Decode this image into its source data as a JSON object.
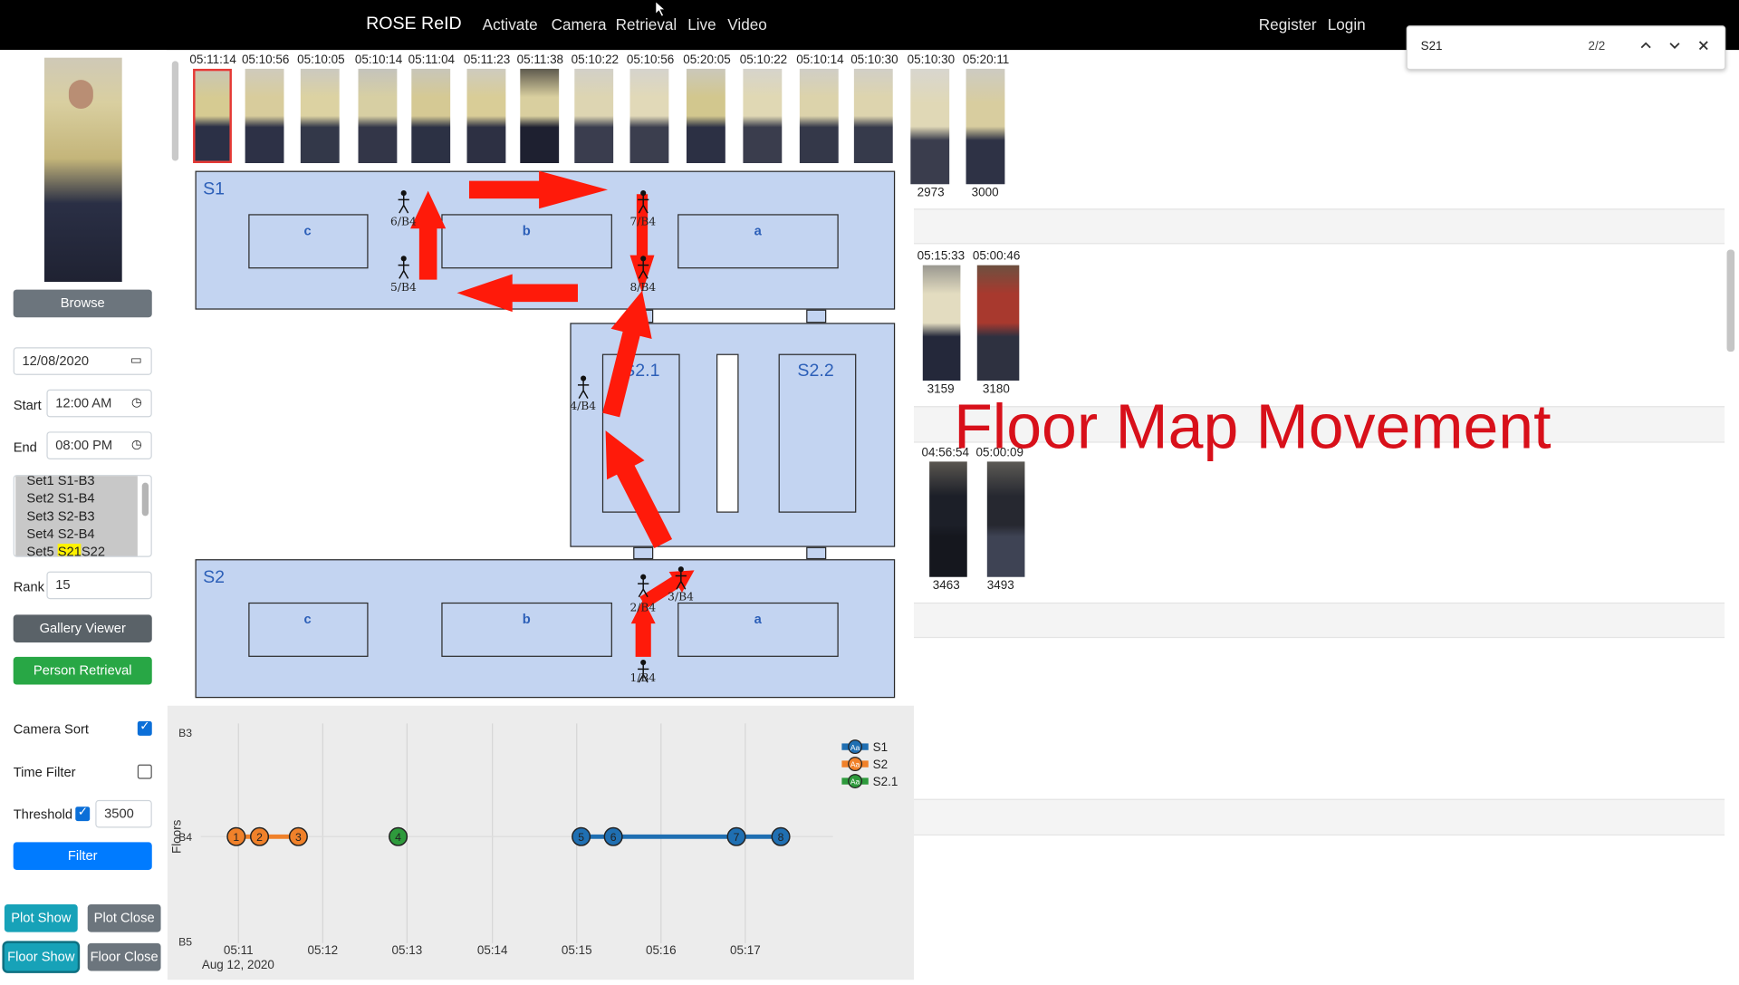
{
  "nav": {
    "brand": "ROSE ReID",
    "links": [
      "Activate",
      "Camera",
      "Retrieval",
      "Live",
      "Video"
    ],
    "register": "Register",
    "login": "Login"
  },
  "find_bar": {
    "query": "S21",
    "count": "2/2"
  },
  "sidebar": {
    "browse": "Browse",
    "date": "12/08/2020",
    "start_label": "Start",
    "start_time": "12:00 AM",
    "end_label": "End",
    "end_time": "08:00 PM",
    "sets": [
      "Set1 S1-B3",
      "Set2 S1-B4",
      "Set3 S2-B3",
      "Set4 S2-B4"
    ],
    "set5_prefix": "Set5 ",
    "set5_highlight": "S21",
    "set5_suffix": "S22",
    "rank_label": "Rank",
    "rank_value": "15",
    "gallery_viewer": "Gallery Viewer",
    "person_retrieval": "Person Retrieval",
    "camera_sort": "Camera Sort",
    "time_filter": "Time Filter",
    "threshold_label": "Threshold",
    "threshold_value": "3500",
    "filter": "Filter",
    "plot_show": "Plot Show",
    "plot_close": "Plot Close",
    "floor_show": "Floor Show",
    "floor_close": "Floor Close",
    "camera_sort_checked": true,
    "time_filter_checked": false,
    "threshold_checked": true
  },
  "thumb_strip": {
    "timestamps": [
      "05:11:14",
      "05:10:56",
      "05:10:05",
      "05:10:14",
      "05:11:04",
      "05:11:23",
      "05:11:38",
      "05:10:22",
      "05:10:56",
      "05:20:05",
      "05:10:22",
      "05:10:14",
      "05:10:30",
      "05:10:30",
      "05:20:11"
    ],
    "ids": [
      "2973",
      "3000"
    ]
  },
  "floor_map": {
    "floors": {
      "s1": "S1",
      "s21": "S2.1",
      "s22": "S2.2",
      "s2": "S2"
    },
    "rooms": [
      "c",
      "b",
      "a"
    ],
    "markers": [
      "6/B4",
      "7/B4",
      "5/B4",
      "8/B4",
      "4/B4",
      "2/B4",
      "3/B4",
      "1/B4"
    ],
    "arrow_color": "#ff1a0a"
  },
  "gallery": {
    "row2_times": [
      "05:15:33",
      "05:00:46"
    ],
    "row2_ids": [
      "3159",
      "3180"
    ],
    "row3_times": [
      "04:56:54",
      "05:00:09"
    ],
    "row3_ids": [
      "3463",
      "3493"
    ]
  },
  "overlay_title": "Floor Map Movement",
  "timeline": {
    "y_labels": [
      "B3",
      "B4",
      "B5"
    ],
    "y_title": "Floors",
    "x_ticks": [
      "05:11",
      "05:12",
      "05:13",
      "05:14",
      "05:15",
      "05:16",
      "05:17"
    ],
    "x_sub": "Aug 12, 2020",
    "legend": [
      {
        "name": "S1",
        "color": "#1f6fb2"
      },
      {
        "name": "S2",
        "color": "#f0812a"
      },
      {
        "name": "S2.1",
        "color": "#2e9a3c"
      }
    ],
    "legend_badge": "Aa",
    "points": [
      {
        "label": "1",
        "series": "S2"
      },
      {
        "label": "2",
        "series": "S2"
      },
      {
        "label": "3",
        "series": "S2"
      },
      {
        "label": "4",
        "series": "S2.1"
      },
      {
        "label": "5",
        "series": "S1"
      },
      {
        "label": "6",
        "series": "S1"
      },
      {
        "label": "7",
        "series": "S1"
      },
      {
        "label": "8",
        "series": "S1"
      }
    ]
  }
}
